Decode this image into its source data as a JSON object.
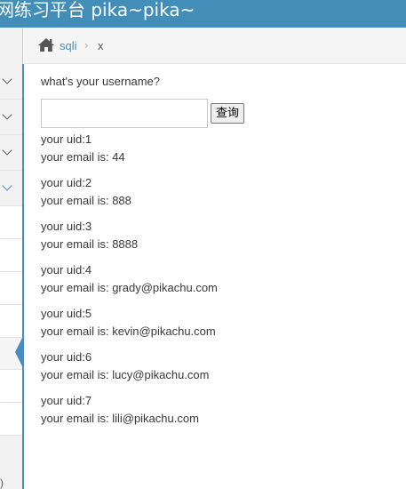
{
  "header": {
    "title": "网练习平台 pika~pika~"
  },
  "sidebar": {
    "bottom_text": ")"
  },
  "breadcrumb": {
    "home_label": "sqli",
    "separator": "›",
    "current": "x"
  },
  "form": {
    "question": "what's your username?",
    "input_value": "",
    "button_label": "查询"
  },
  "results": [
    {
      "uid_line": "your uid:1",
      "email_line": "your email is: 44"
    },
    {
      "uid_line": "your uid:2",
      "email_line": "your email is: 888"
    },
    {
      "uid_line": "your uid:3",
      "email_line": "your email is: 8888"
    },
    {
      "uid_line": "your uid:4",
      "email_line": "your email is: grady@pikachu.com"
    },
    {
      "uid_line": "your uid:5",
      "email_line": "your email is: kevin@pikachu.com"
    },
    {
      "uid_line": "your uid:6",
      "email_line": "your email is: lucy@pikachu.com"
    },
    {
      "uid_line": "your uid:7",
      "email_line": "your email is: lili@pikachu.com"
    }
  ],
  "colors": {
    "header_bg": "#438eb9",
    "link": "#4c8fbd",
    "active_accent": "#4a8bc2"
  }
}
